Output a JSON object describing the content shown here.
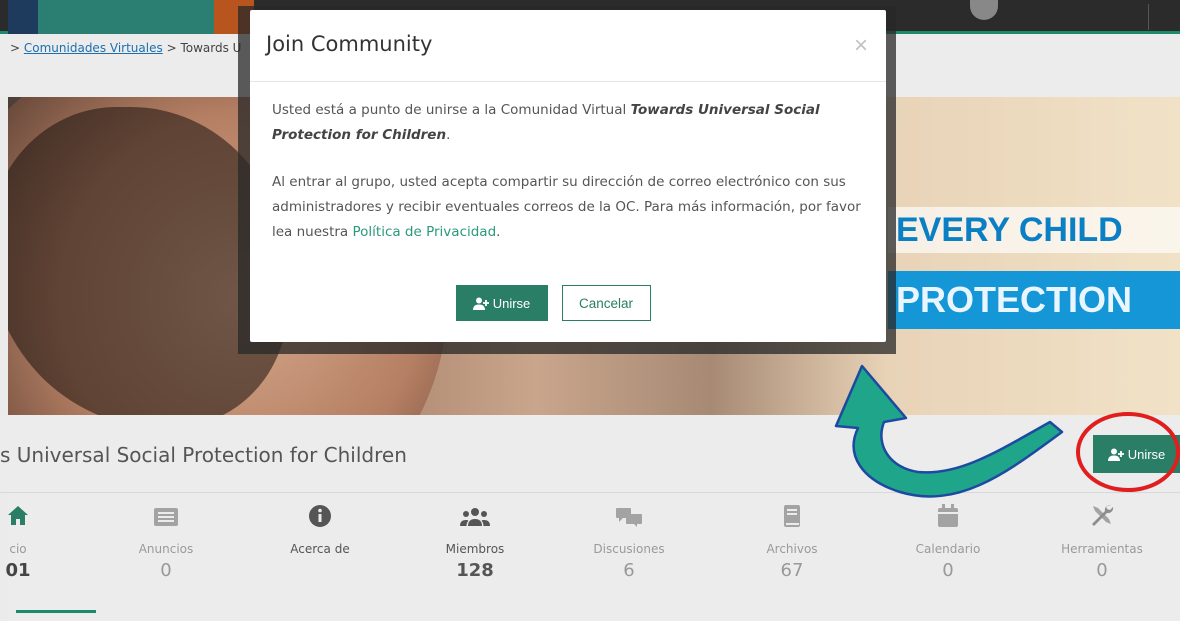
{
  "breadcrumb": {
    "sep": ">",
    "link": "Comunidades Virtuales",
    "current": "Towards U"
  },
  "banner": {
    "slogan1": "EVERY CHILD",
    "slogan2": "PROTECTION"
  },
  "community": {
    "title": "s Universal Social Protection for Children",
    "join_label": "Unirse"
  },
  "stats": [
    {
      "label": "cio",
      "value": "01",
      "icon": "home-icon"
    },
    {
      "label": "Anuncios",
      "value": "0",
      "icon": "newspaper-icon"
    },
    {
      "label": "Acerca de",
      "value": "",
      "icon": "info-icon"
    },
    {
      "label": "Miembros",
      "value": "128",
      "icon": "users-icon"
    },
    {
      "label": "Discusiones",
      "value": "6",
      "icon": "comments-icon"
    },
    {
      "label": "Archivos",
      "value": "67",
      "icon": "book-icon"
    },
    {
      "label": "Calendario",
      "value": "0",
      "icon": "calendar-icon"
    },
    {
      "label": "Herramientas",
      "value": "0",
      "icon": "tools-icon"
    }
  ],
  "modal": {
    "title": "Join Community",
    "close": "×",
    "p1_prefix": "Usted está a punto de unirse a la Comunidad Virtual ",
    "p1_name": "Towards Universal Social Protection for Children",
    "p1_suffix": ".",
    "p2_text": "Al entrar al grupo, usted acepta compartir su dirección de correo electrónico con sus administradores y recibir eventuales correos de la OC. Para más información, por favor lea nuestra ",
    "p2_link": "Política de Privacidad",
    "p2_end": ".",
    "join_label": "Unirse",
    "cancel_label": "Cancelar"
  },
  "colors": {
    "accent": "#2a7e66",
    "annotation_red": "#e01e1e",
    "arrow_fill": "#1fa58a",
    "arrow_stroke": "#1d4aa0"
  }
}
